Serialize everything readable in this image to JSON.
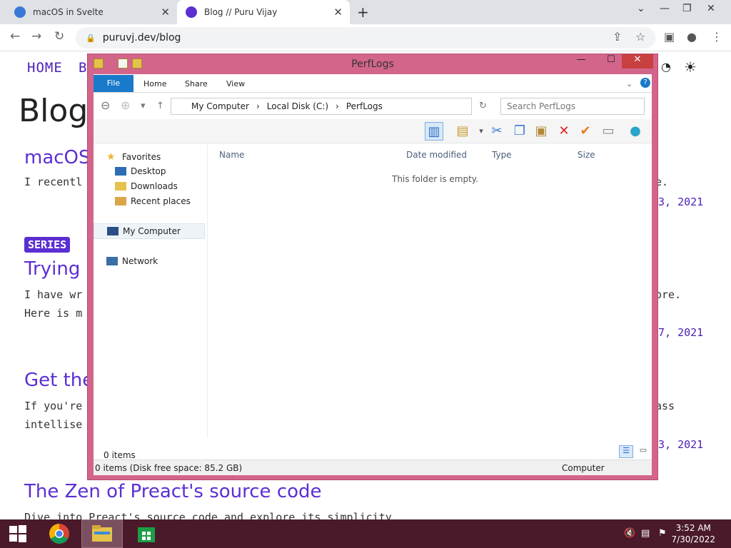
{
  "browser": {
    "tabs": [
      {
        "title": "macOS in Svelte",
        "favicon_color": "#3a78d8"
      },
      {
        "title": "Blog // Puru Vijay",
        "favicon_color": "#5b2fd3"
      }
    ],
    "url": "puruvj.dev/blog"
  },
  "page": {
    "nav": [
      "HOME",
      "B"
    ],
    "title": "Blog",
    "series_badge": "SERIES",
    "posts": [
      {
        "heading": "macOS",
        "text1": "I recentl",
        "text_right": "e.",
        "date_right": "3, 2021"
      },
      {
        "heading": "Trying",
        "text1": "I have wr",
        "text2": "Here is m",
        "text_right": "ore.",
        "date_right": "7, 2021"
      },
      {
        "heading": "Get the",
        "text1": "If you're",
        "text2": "intellise",
        "text_right": "ass",
        "date_right": "3, 2021"
      },
      {
        "heading": "The Zen of Preact's source code",
        "text1": "Dive into Preact's source code and explore its simplicity"
      }
    ]
  },
  "explorer": {
    "title": "PerfLogs",
    "ribbon_tabs": [
      "File",
      "Home",
      "Share",
      "View"
    ],
    "address": [
      "My Computer",
      "Local Disk (C:)",
      "PerfLogs"
    ],
    "search_placeholder": "Search PerfLogs",
    "nav": {
      "favorites": "Favorites",
      "desktop": "Desktop",
      "downloads": "Downloads",
      "recent": "Recent places",
      "computer": "My Computer",
      "network": "Network"
    },
    "columns": [
      "Name",
      "Date modified",
      "Type",
      "Size"
    ],
    "empty_message": "This folder is empty.",
    "item_count": "0 items",
    "status_left": "0 items (Disk free space: 85.2 GB)",
    "status_right": "Computer"
  },
  "taskbar": {
    "time": "3:52 AM",
    "date": "7/30/2022"
  }
}
